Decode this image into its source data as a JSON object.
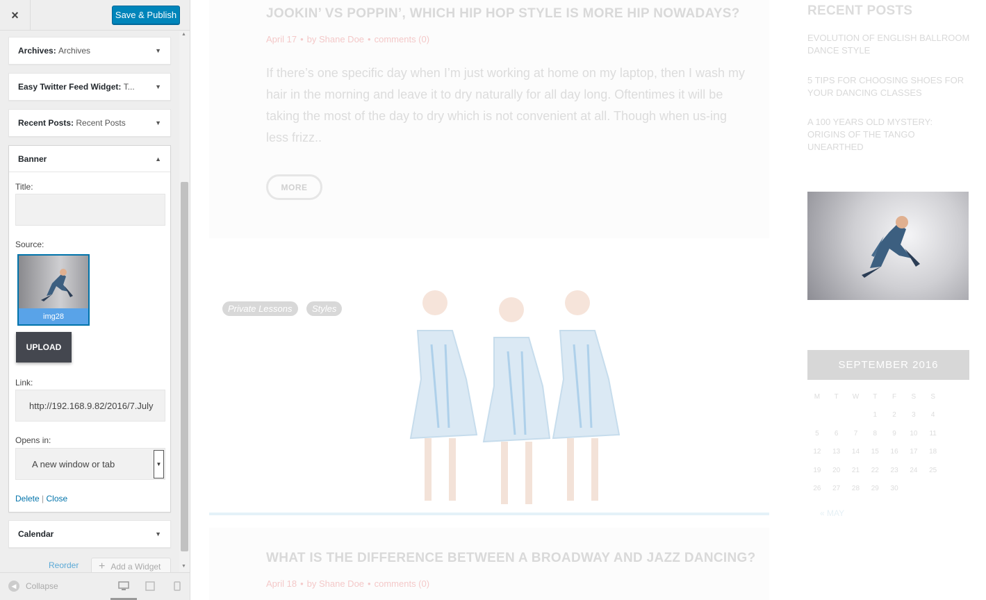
{
  "customizer": {
    "close_icon": "×",
    "publish_label": "Save & Publish",
    "widgets": [
      {
        "type": "Archives:",
        "title": "Archives"
      },
      {
        "type": "Easy Twitter Feed Widget:",
        "title": "T..."
      },
      {
        "type": "Recent Posts:",
        "title": "Recent Posts"
      }
    ],
    "banner": {
      "name": "Banner",
      "title_label": "Title:",
      "title_value": "",
      "source_label": "Source:",
      "source_image_caption": "img28",
      "upload_label": "UPLOAD",
      "link_label": "Link:",
      "link_value": "http://192.168.9.82/2016/7.July",
      "opens_label": "Opens in:",
      "opens_value": "A new window or tab",
      "delete_label": "Delete",
      "separator": "|",
      "close_label": "Close"
    },
    "calendar_widget": "Calendar",
    "reorder_label": "Reorder",
    "add_widget_label": "Add a Widget",
    "collapse_label": "Collapse"
  },
  "preview": {
    "post1": {
      "title": "JOOKIN’ VS POPPIN’, WHICH HIP HOP STYLE IS MORE HIP NOWADAYS?",
      "date": "April 17",
      "author": "by Shane Doe",
      "comments": "comments (0)",
      "excerpt": "If there’s one specific day when I’m just working at home on my laptop, then I wash my hair in the morning and leave it to dry naturally for all day long. Oftentimes it will be taking the most of the day to dry which is not convenient at all. Though when us-ing less frizz..",
      "more_label": "MORE"
    },
    "tags": [
      "Private Lessons",
      "Styles"
    ],
    "post2": {
      "title": "WHAT IS THE DIFFERENCE BETWEEN A BROADWAY AND JAZZ DANCING?",
      "date": "April 18",
      "author": "by Shane Doe",
      "comments": "comments (0)"
    },
    "recent_posts_title": "RECENT POSTS",
    "recent_posts": [
      "EVOLUTION OF ENGLISH BALLROOM DANCE STYLE",
      "5 TIPS FOR CHOOSING SHOES FOR YOUR DANCING CLASSES",
      "A 100 YEARS OLD MYSTERY: ORIGINS OF THE TANGO UNEARTHED"
    ],
    "calendar": {
      "month": "SEPTEMBER 2016",
      "weekdays": [
        "M",
        "T",
        "W",
        "T",
        "F",
        "S",
        "S"
      ],
      "weeks": [
        [
          "",
          "",
          "",
          "1",
          "2",
          "3",
          "4"
        ],
        [
          "5",
          "6",
          "7",
          "8",
          "9",
          "10",
          "11"
        ],
        [
          "12",
          "13",
          "14",
          "15",
          "16",
          "17",
          "18"
        ],
        [
          "19",
          "20",
          "21",
          "22",
          "23",
          "24",
          "25"
        ],
        [
          "26",
          "27",
          "28",
          "29",
          "30",
          "",
          ""
        ]
      ],
      "prev_label": "« MAY"
    }
  },
  "colors": {
    "primary": "#0085ba",
    "link": "#0073aa",
    "upload": "#44474f"
  }
}
